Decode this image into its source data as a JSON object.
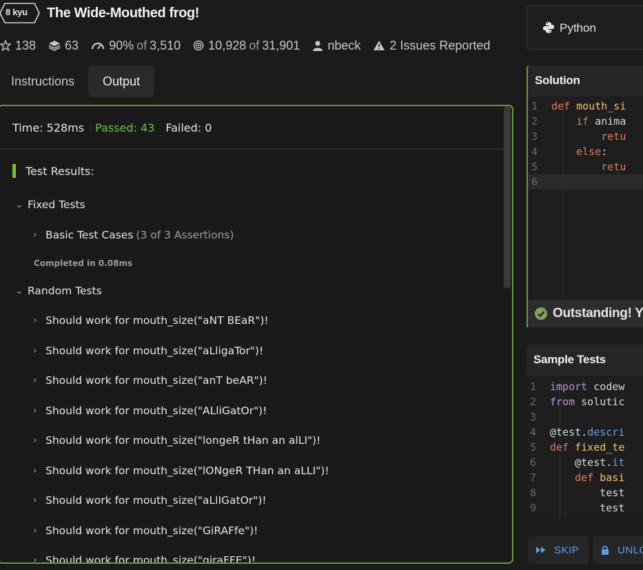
{
  "kata": {
    "rank": "8 kyu",
    "title": "The Wide-Mouthed frog!"
  },
  "stats": {
    "stars": "138",
    "collections": "63",
    "satisfaction_pct": "90%",
    "satisfaction_of": "of",
    "satisfaction_total": "3,510",
    "completed": "10,928",
    "completed_of": "of",
    "completed_total": "31,901",
    "author": "nbeck",
    "issues": "2 Issues Reported"
  },
  "tabs": {
    "instructions": "Instructions",
    "output": "Output"
  },
  "output": {
    "time": "Time: 528ms",
    "passed": "Passed: 43",
    "failed": "Failed: 0",
    "results_heading": "Test Results:",
    "fixed_group": "Fixed Tests",
    "basic_case": "Basic Test Cases",
    "basic_case_count": "(3 of 3 Assertions)",
    "completed_in": "Completed in 0.08ms",
    "random_group": "Random Tests",
    "random_items": [
      "Should work for mouth_size(\"aNT BEaR\")!",
      "Should work for mouth_size(\"aLligaTor\")!",
      "Should work for mouth_size(\"anT beAR\")!",
      "Should work for mouth_size(\"ALliGatOr\")!",
      "Should work for mouth_size(\"longeR tHan an alLI\")!",
      "Should work for mouth_size(\"lONgeR THan an aLLI\")!",
      "Should work for mouth_size(\"aLlIGatOr\")!",
      "Should work for mouth_size(\"GiRAFfe\")!",
      "Should work for mouth_size(\"giraFFE\")!"
    ]
  },
  "language": "Python",
  "solution": {
    "title": "Solution",
    "status": "Outstanding! Yo"
  },
  "sample_tests": {
    "title": "Sample Tests"
  },
  "buttons": {
    "skip": "SKIP",
    "unlock": "UNLO"
  },
  "colors": {
    "accent_green": "#6ec23a",
    "panel_border": "#6a9a32",
    "link_blue": "#5aa0e6"
  }
}
